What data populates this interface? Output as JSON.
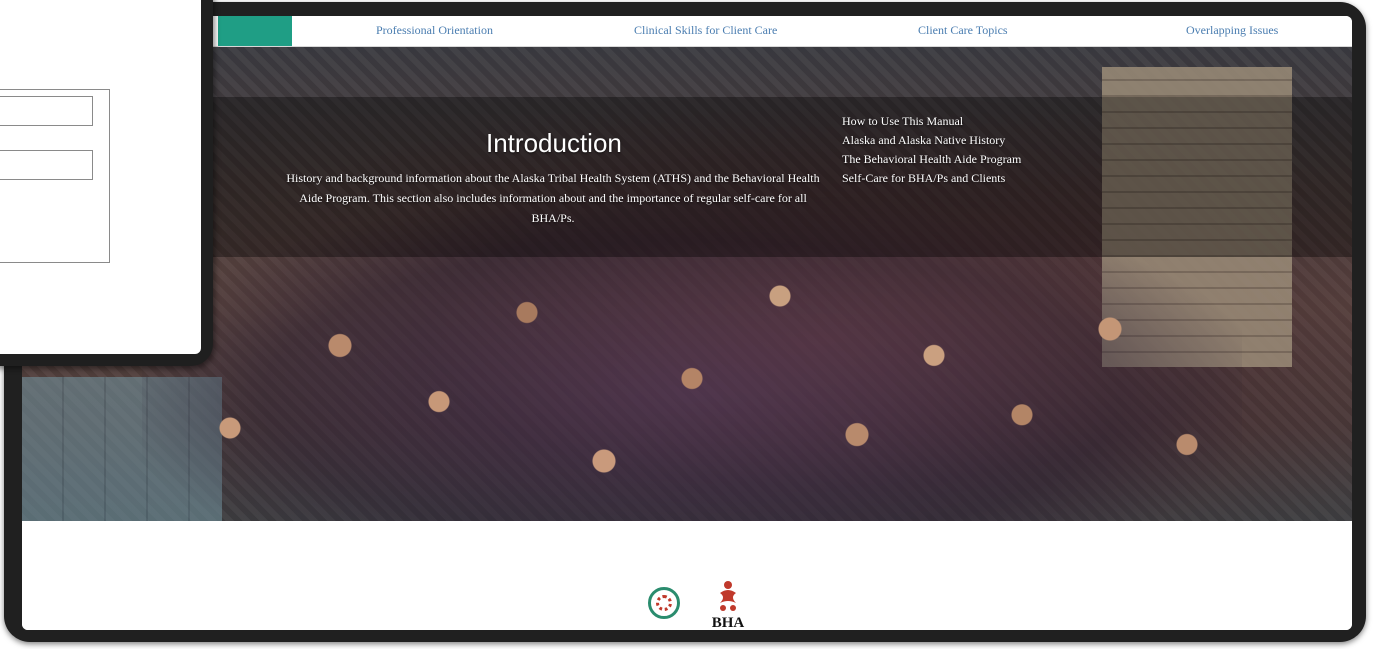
{
  "nav": {
    "items": [
      {
        "label": "Professional Orientation"
      },
      {
        "label": "Clinical Skills for Client Care"
      },
      {
        "label": "Client Care Topics"
      },
      {
        "label": "Overlapping Issues"
      }
    ]
  },
  "hero": {
    "title": "Introduction",
    "description": "History and background information about the Alaska Tribal Health System (ATHS) and the Behavioral Health Aide Program. This section also includes information about and the importance of regular self-care for all BHA/Ps.",
    "links": [
      {
        "label": "How to Use This Manual"
      },
      {
        "label": "Alaska and Alaska Native History"
      },
      {
        "label": "The Behavioral Health Aide Program"
      },
      {
        "label": "Self-Care for BHA/Ps and Clients"
      }
    ]
  },
  "footer": {
    "bha_logo_text": "BHA"
  },
  "colors": {
    "nav_accent": "#1f9e85",
    "nav_link": "#4a7db0",
    "frame": "#202020",
    "seal_ring": "#2a8c6e",
    "bha_red": "#c0392b"
  },
  "icons": {
    "seal": "tribal-seal-icon",
    "bha_mark": "bha-logo-icon"
  }
}
